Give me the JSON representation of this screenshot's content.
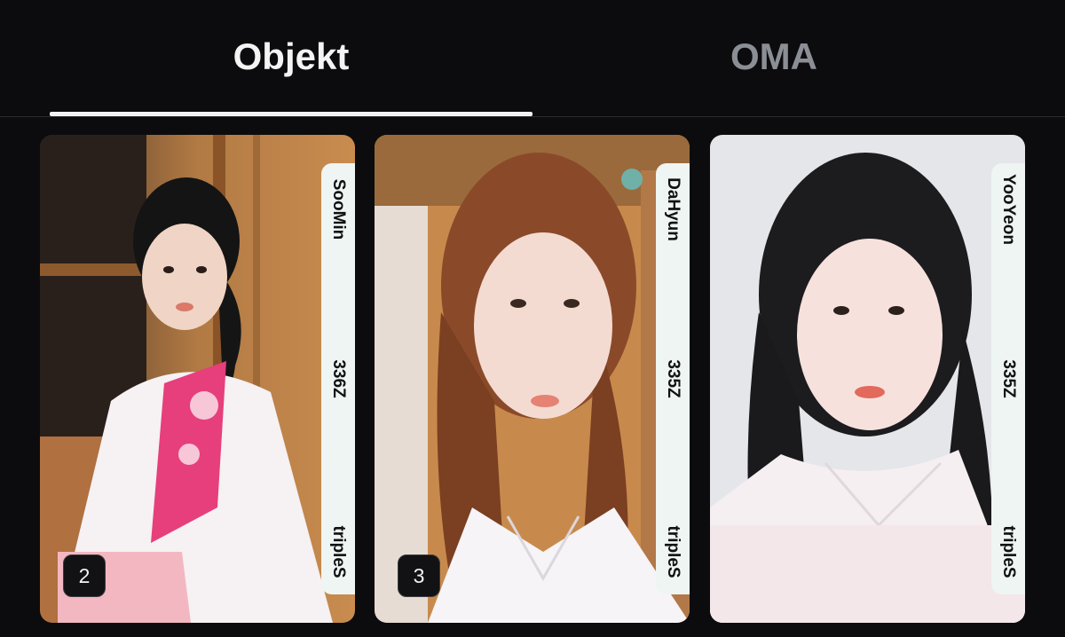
{
  "tabs": [
    {
      "label": "Objekt",
      "active": true
    },
    {
      "label": "OMA",
      "active": false
    }
  ],
  "objekts": [
    {
      "member": "SooMin",
      "serial": "336Z",
      "group": "tripleS",
      "copies": "2",
      "band_color": "#eef5f3"
    },
    {
      "member": "DaHyun",
      "serial": "335Z",
      "group": "tripleS",
      "copies": "3",
      "band_color": "#eef5f3"
    },
    {
      "member": "YooYeon",
      "serial": "335Z",
      "group": "tripleS",
      "copies": null,
      "band_color": "#eef5f3"
    }
  ],
  "colors": {
    "background": "#0c0c0e",
    "tab_active": "#f4f4f4",
    "tab_inactive": "#8b8f95",
    "indicator": "#f2f2f2"
  }
}
